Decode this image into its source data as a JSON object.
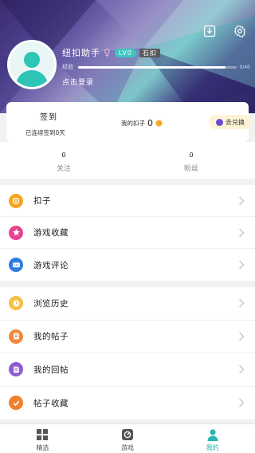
{
  "header": {
    "username": "纽扣助手",
    "gender_symbol": "♀",
    "level": "LV0",
    "title": "石扣",
    "exp_label": "经验",
    "exp_value": "0/40",
    "exp_progress": 0.0,
    "login_link": "点击登录",
    "icons": [
      "download-icon",
      "settings-gear-icon"
    ]
  },
  "sign": {
    "title": "签到",
    "subtitle": "已连续签到0天",
    "coins_label": "我的扣子",
    "coins_value": "0",
    "exchange_label": "去兑换"
  },
  "stats": {
    "following": {
      "count": "0",
      "label": "关注"
    },
    "fans": {
      "count": "0",
      "label": "粉丝"
    }
  },
  "menu1": [
    {
      "label": "扣子",
      "icon": "coin-icon",
      "color": "#f5a623"
    },
    {
      "label": "游戏收藏",
      "icon": "star-icon",
      "color": "#e84393"
    },
    {
      "label": "游戏评论",
      "icon": "comment-icon",
      "color": "#2f7de1"
    }
  ],
  "menu2": [
    {
      "label": "浏览历史",
      "icon": "clock-icon",
      "color": "#f5c043"
    },
    {
      "label": "我的帖子",
      "icon": "post-icon",
      "color": "#f08a3c"
    },
    {
      "label": "我的回帖",
      "icon": "reply-icon",
      "color": "#8e5bd6"
    },
    {
      "label": "帖子收藏",
      "icon": "check-favorite-icon",
      "color": "#f0802c"
    }
  ],
  "tabbar": [
    {
      "label": "精选",
      "icon": "grid-icon",
      "active": false
    },
    {
      "label": "游戏",
      "icon": "game-icon",
      "active": false
    },
    {
      "label": "我的",
      "icon": "person-icon",
      "active": true
    }
  ],
  "colors": {
    "accent": "#2bb5ae",
    "avatar": "#2ec4b6"
  }
}
